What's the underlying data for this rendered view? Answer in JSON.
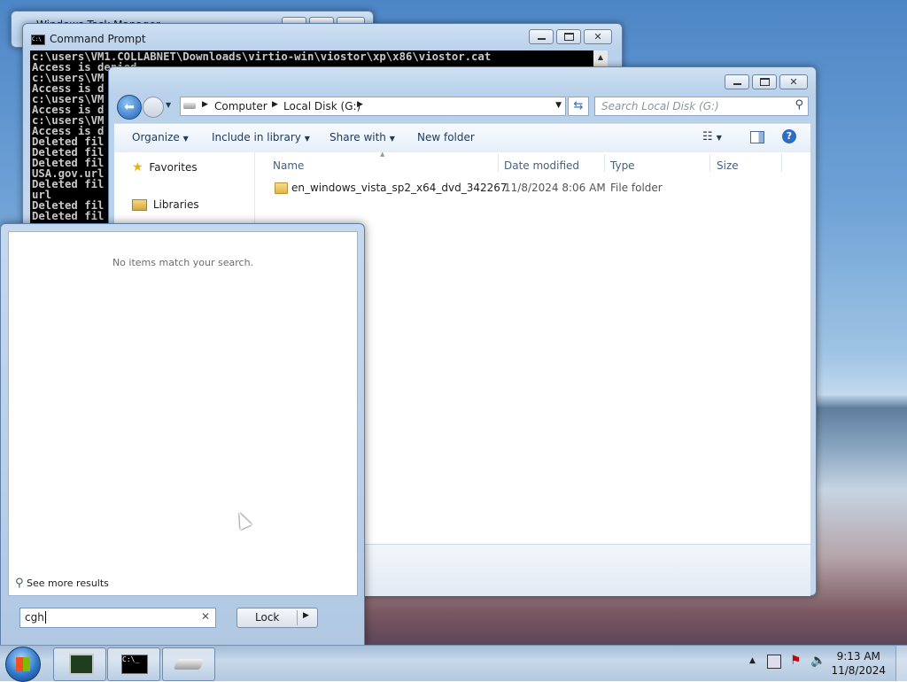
{
  "bg_window": {
    "title": "Windows Task Manager"
  },
  "cmd": {
    "title": "Command Prompt",
    "lines": [
      "c:\\users\\VM1.COLLABNET\\Downloads\\virtio-win\\viostor\\xp\\x86\\viostor.cat",
      "Access is denied.",
      "c:\\users\\VM",
      "Access is d",
      "c:\\users\\VM",
      "Access is d",
      "c:\\users\\VM",
      "Access is d",
      "Deleted fil",
      "Deleted fil",
      "Deleted fil",
      "USA.gov.url",
      "Deleted fil",
      "url",
      "Deleted fil",
      "Deleted fil"
    ]
  },
  "explorer": {
    "breadcrumb": [
      "Computer",
      "Local Disk (G:)"
    ],
    "search_placeholder": "Search Local Disk (G:)",
    "toolbar": {
      "organize": "Organize",
      "include": "Include in library",
      "share": "Share with",
      "new_folder": "New folder"
    },
    "nav": {
      "favorites": "Favorites",
      "libraries": "Libraries"
    },
    "columns": {
      "name": "Name",
      "date": "Date modified",
      "type": "Type",
      "size": "Size"
    },
    "files": [
      {
        "name": "en_windows_vista_sp2_x64_dvd_342267",
        "date": "11/8/2024 8:06 AM",
        "type": "File folder",
        "size": ""
      }
    ]
  },
  "start_menu": {
    "no_results": "No items match your search.",
    "see_more": "See more results",
    "search_value": "cgh",
    "lock_label": "Lock"
  },
  "taskbar": {
    "time": "9:13 AM",
    "date": "11/8/2024"
  },
  "colors": {
    "accent": "#1e395b",
    "console_bg": "#000000"
  }
}
